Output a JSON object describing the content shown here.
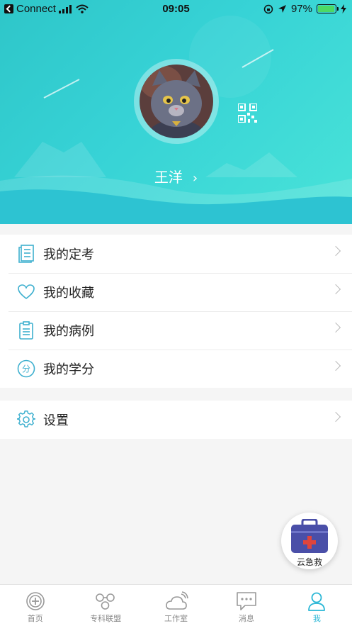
{
  "status_bar": {
    "carrier": "Connect",
    "time": "09:05",
    "battery": "97%",
    "battery_level": 0.97
  },
  "profile": {
    "username": "王洋",
    "chevron": "›"
  },
  "menu_group_1": [
    {
      "label": "我的定考",
      "icon": "exam-icon"
    },
    {
      "label": "我的收藏",
      "icon": "heart-icon"
    },
    {
      "label": "我的病例",
      "icon": "clipboard-icon"
    },
    {
      "label": "我的学分",
      "icon": "credit-icon"
    }
  ],
  "menu_group_2": [
    {
      "label": "设置",
      "icon": "gear-icon"
    }
  ],
  "fab": {
    "label": "云急救",
    "icon": "first-aid-kit-icon"
  },
  "tabbar": [
    {
      "label": "首页",
      "icon": "home-icon",
      "active": false
    },
    {
      "label": "专科联盟",
      "icon": "alliance-icon",
      "active": false
    },
    {
      "label": "工作室",
      "icon": "cloud-icon",
      "active": false
    },
    {
      "label": "消息",
      "icon": "message-icon",
      "active": false
    },
    {
      "label": "我",
      "icon": "person-icon",
      "active": true
    }
  ],
  "colors": {
    "accent": "#2ab7d6",
    "header_start": "#2ec6c9",
    "header_end": "#49e3d8"
  }
}
